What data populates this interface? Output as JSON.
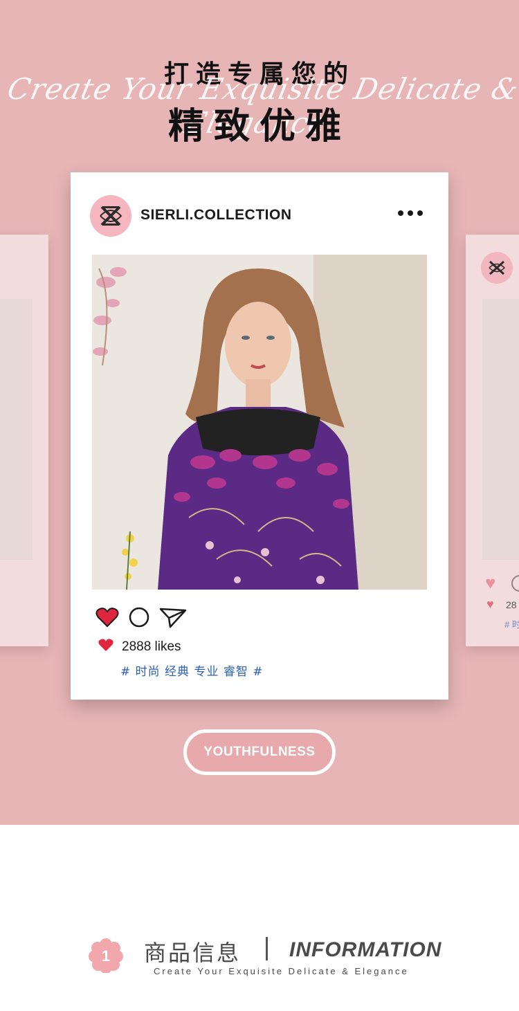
{
  "hero": {
    "title_line1": "打造专属您的",
    "script_text": "Create Your Exquisite Delicate & Elegance",
    "title_line2": "精致优雅",
    "background_color": "#e8b5b7"
  },
  "post": {
    "brand": "SIERLI.COLLECTION",
    "logo_icon": "sierli-logo-icon",
    "more_icon": "more-dots-icon",
    "likes": "2888 likes",
    "tags": "# 时尚 经典 专业 睿智 #",
    "action_icons": [
      "heart-icon",
      "comment-circle-icon",
      "send-icon"
    ]
  },
  "side_card": {
    "likes_partial": "28",
    "tags_partial": "# 时"
  },
  "badge": {
    "label": "YOUTHFULNESS"
  },
  "info": {
    "number": "1",
    "title_cn": "商品信息",
    "title_en": "INFORMATION",
    "subtitle": "Create Your Exquisite Delicate & Elegance"
  },
  "colors": {
    "accent_pink": "#e8a9ad",
    "heart_red": "#e0253f",
    "tag_blue": "#2b5fb8"
  }
}
